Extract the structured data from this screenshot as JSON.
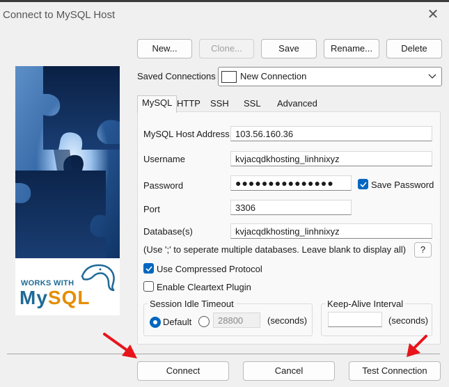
{
  "window": {
    "title": "Connect to MySQL Host",
    "close_symbol": "✕"
  },
  "toolbar": {
    "new_label": "New...",
    "clone_label": "Clone...",
    "save_label": "Save",
    "rename_label": "Rename...",
    "delete_label": "Delete"
  },
  "saved_connections": {
    "label": "Saved Connections",
    "value": "New Connection"
  },
  "tabs": [
    "MySQL",
    "HTTP",
    "SSH",
    "SSL",
    "Advanced"
  ],
  "form": {
    "host_label": "MySQL Host Address",
    "host_value": "103.56.160.36",
    "username_label": "Username",
    "username_value": "kvjacqdkhosting_linhnixyz",
    "password_label": "Password",
    "password_value": "●●●●●●●●●●●●●●●",
    "save_password_label": "Save Password",
    "save_password_checked": true,
    "port_label": "Port",
    "port_value": "3306",
    "databases_label": "Database(s)",
    "databases_value": "kvjacqdkhosting_linhnixyz",
    "databases_hint": "(Use ';' to seperate multiple databases. Leave blank to display all)",
    "help_label": "?",
    "compressed_label": "Use Compressed Protocol",
    "compressed_checked": true,
    "cleartext_label": "Enable Cleartext Plugin",
    "cleartext_checked": false
  },
  "session_idle": {
    "title": "Session Idle Timeout",
    "default_label": "Default",
    "custom_value": "28800",
    "unit": "(seconds)",
    "selected": "Default"
  },
  "keep_alive": {
    "title": "Keep-Alive Interval",
    "value": "",
    "unit": "(seconds)"
  },
  "footer": {
    "connect_label": "Connect",
    "cancel_label": "Cancel",
    "test_label": "Test Connection"
  },
  "logo": {
    "works_with": "WORKS WITH",
    "brand_my": "My",
    "brand_sql": "SQL"
  },
  "colors": {
    "accent": "#0067c0",
    "arrow": "#e8141b",
    "mysql_blue": "#1f6a96",
    "mysql_orange": "#e48e00"
  }
}
